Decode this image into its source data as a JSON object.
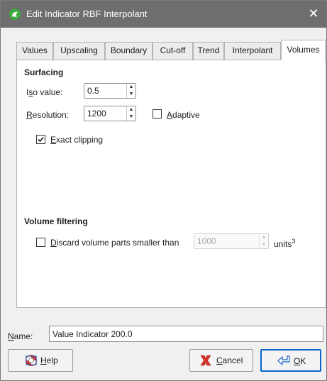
{
  "window": {
    "title": "Edit Indicator RBF Interpolant",
    "close_glyph": "✕",
    "app_icon": "leapfrog-app-icon",
    "app_icon_color": "#3fa83f"
  },
  "tabs": [
    {
      "label": "Values",
      "active": false
    },
    {
      "label": "Upscaling",
      "active": false
    },
    {
      "label": "Boundary",
      "active": false
    },
    {
      "label": "Cut-off",
      "active": false
    },
    {
      "label": "Trend",
      "active": false
    },
    {
      "label": "Interpolant",
      "active": false
    },
    {
      "label": "Volumes",
      "active": true
    }
  ],
  "surfacing": {
    "title": "Surfacing",
    "iso_value": {
      "label_pre": "I",
      "label_mnemonic": "s",
      "label_post": "o value:",
      "value": "0.5"
    },
    "resolution": {
      "label_pre": "",
      "label_mnemonic": "R",
      "label_post": "esolution:",
      "value": "1200"
    },
    "adaptive": {
      "label_pre": "",
      "label_mnemonic": "A",
      "label_post": "daptive",
      "checked": false
    },
    "exact_clipping": {
      "label_pre": "",
      "label_mnemonic": "E",
      "label_post": "xact clipping",
      "checked": true
    }
  },
  "volume_filtering": {
    "title": "Volume filtering",
    "discard": {
      "label_pre": "",
      "label_mnemonic": "D",
      "label_post": "iscard volume parts smaller than",
      "checked": false
    },
    "threshold": {
      "value": "1000",
      "enabled": false
    },
    "units": "units",
    "units_sup": "3"
  },
  "name": {
    "label_pre": "",
    "label_mnemonic": "N",
    "label_post": "ame:",
    "value": "Value Indicator 200.0"
  },
  "buttons": {
    "help": {
      "label_pre": "",
      "label_mnemonic": "H",
      "label_post": "elp",
      "icon": "lifebuoy-icon"
    },
    "cancel": {
      "label_pre": "",
      "label_mnemonic": "C",
      "label_post": "ancel",
      "icon": "red-x-icon"
    },
    "ok": {
      "label_pre": "",
      "label_mnemonic": "O",
      "label_post": "K",
      "icon": "ok-arrow-icon"
    }
  },
  "colors": {
    "titlebar": "#6e6e6e",
    "default_button_border": "#0a64c8"
  }
}
